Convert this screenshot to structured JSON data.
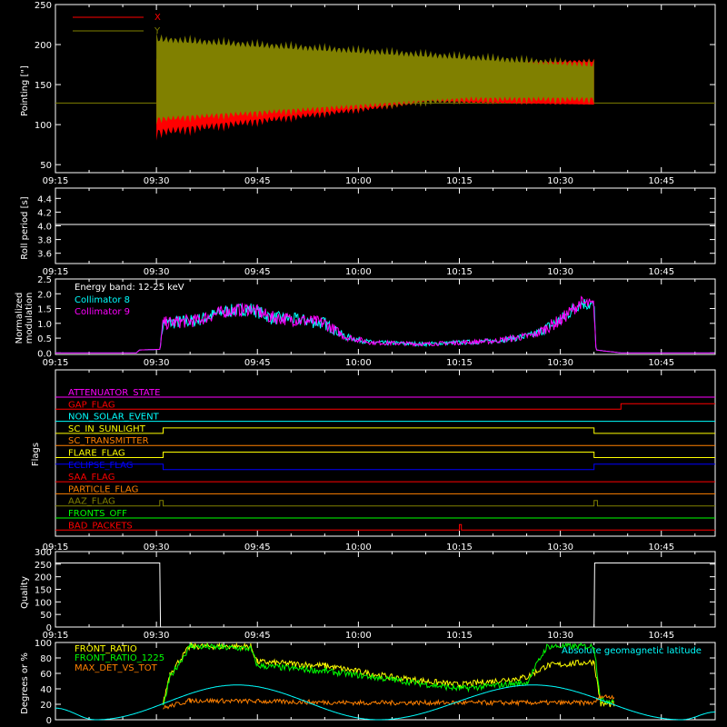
{
  "time_ticks": [
    "09:15",
    "09:30",
    "09:45",
    "10:00",
    "10:15",
    "10:30",
    "10:45"
  ],
  "chart_data": [
    {
      "type": "line",
      "id": "pointing",
      "ylabel": "Pointing [\"]",
      "ylim": [
        40,
        250
      ],
      "yticks": [
        50,
        100,
        150,
        200,
        250
      ],
      "xlim": [
        "09:15",
        "10:53"
      ],
      "legend": [
        {
          "name": "X",
          "color": "#ff0000"
        },
        {
          "name": "Y",
          "color": "#808000"
        }
      ],
      "reference_line": 127,
      "series": [
        {
          "name": "X",
          "color": "#ff0000",
          "start": "09:30",
          "end": "10:35",
          "upper": 183,
          "lower_start": 80,
          "lower_end": 125
        },
        {
          "name": "Y",
          "color": "#808000",
          "start": "09:30",
          "end": "10:35",
          "upper_peak": 215,
          "upper_end": 183,
          "lower_start": 100,
          "lower_end": 125
        }
      ]
    },
    {
      "type": "line",
      "id": "roll",
      "ylabel": "Roll period [s]",
      "ylim": [
        3.45,
        4.55
      ],
      "yticks": [
        3.6,
        3.8,
        4.0,
        4.2,
        4.4
      ],
      "value": 4.02
    },
    {
      "type": "line",
      "id": "modulation",
      "ylabel": [
        "Normalized",
        "modulation"
      ],
      "ylim": [
        -0.05,
        2.5
      ],
      "yticks": [
        0.0,
        0.5,
        1.0,
        1.5,
        2.0,
        2.5
      ],
      "annotation": "Energy band: 12-25 keV",
      "series": [
        {
          "name": "Collimator 8",
          "color": "#00ffff"
        },
        {
          "name": "Collimator 9",
          "color": "#ff00ff"
        }
      ],
      "profile": [
        [
          "09:15",
          0.0
        ],
        [
          "09:27",
          0.0
        ],
        [
          "09:27.5",
          0.1
        ],
        [
          "09:30.5",
          0.12
        ],
        [
          "09:31",
          1.0
        ],
        [
          "09:36",
          1.1
        ],
        [
          "09:40",
          1.4
        ],
        [
          "09:44",
          1.5
        ],
        [
          "09:47",
          1.2
        ],
        [
          "09:52",
          1.1
        ],
        [
          "09:55",
          1.0
        ],
        [
          "09:58",
          0.55
        ],
        [
          "10:02",
          0.35
        ],
        [
          "10:10",
          0.3
        ],
        [
          "10:15",
          0.35
        ],
        [
          "10:20",
          0.4
        ],
        [
          "10:26",
          0.6
        ],
        [
          "10:30",
          1.1
        ],
        [
          "10:33",
          1.7
        ],
        [
          "10:35",
          1.6
        ],
        [
          "10:35.3",
          0.1
        ],
        [
          "10:39",
          0.0
        ],
        [
          "10:53",
          0.0
        ]
      ]
    },
    {
      "type": "line",
      "id": "flags",
      "ylabel": "Flags",
      "flags": [
        {
          "name": "ATTENUATOR_STATE",
          "color": "#ff00ff",
          "steps": [
            [
              "09:15",
              0
            ],
            [
              "10:53",
              0
            ]
          ]
        },
        {
          "name": "GAP_FLAG",
          "color": "#ff0000",
          "steps": [
            [
              "09:15",
              0
            ],
            [
              "10:39",
              1
            ],
            [
              "10:53",
              1
            ]
          ]
        },
        {
          "name": "NON_SOLAR_EVENT",
          "color": "#00ffff",
          "steps": [
            [
              "09:15",
              0
            ],
            [
              "10:53",
              0
            ]
          ]
        },
        {
          "name": "SC_IN_SUNLIGHT",
          "color": "#ffff00",
          "steps": [
            [
              "09:15",
              0
            ],
            [
              "09:31",
              1
            ],
            [
              "10:35",
              0
            ],
            [
              "10:53",
              0
            ]
          ]
        },
        {
          "name": "SC_TRANSMITTER",
          "color": "#ff8000",
          "steps": [
            [
              "09:15",
              0
            ],
            [
              "10:53",
              0
            ]
          ]
        },
        {
          "name": "FLARE_FLAG",
          "color": "#ffff00",
          "steps": [
            [
              "09:15",
              0
            ],
            [
              "09:31",
              1
            ],
            [
              "10:35",
              0
            ],
            [
              "10:53",
              0
            ]
          ]
        },
        {
          "name": "ECLIPSE_FLAG",
          "color": "#0000ff",
          "steps": [
            [
              "09:15",
              1
            ],
            [
              "09:31",
              0
            ],
            [
              "10:35",
              1
            ],
            [
              "10:53",
              1
            ]
          ]
        },
        {
          "name": "SAA_FLAG",
          "color": "#ff0000",
          "steps": [
            [
              "09:15",
              0
            ],
            [
              "10:53",
              0
            ]
          ]
        },
        {
          "name": "PARTICLE_FLAG",
          "color": "#ff8000",
          "steps": [
            [
              "09:15",
              0
            ],
            [
              "10:53",
              0
            ]
          ]
        },
        {
          "name": "AAZ_FLAG",
          "color": "#808000",
          "steps": [
            [
              "09:15",
              0
            ],
            [
              "09:30.5",
              1
            ],
            [
              "09:31",
              0
            ],
            [
              "10:35",
              1
            ],
            [
              "10:35.5",
              0
            ],
            [
              "10:53",
              0
            ]
          ]
        },
        {
          "name": "FRONTS_OFF",
          "color": "#00ff00",
          "steps": [
            [
              "09:15",
              0
            ],
            [
              "10:53",
              0
            ]
          ]
        },
        {
          "name": "BAD_PACKETS",
          "color": "#ff0000",
          "steps": [
            [
              "09:15",
              0
            ],
            [
              "10:15",
              1
            ],
            [
              "10:15.3",
              0
            ],
            [
              "10:53",
              0
            ]
          ]
        }
      ]
    },
    {
      "type": "line",
      "id": "quality",
      "ylabel": "Quality",
      "ylim": [
        0,
        300
      ],
      "yticks": [
        0,
        50,
        100,
        150,
        200,
        250,
        300
      ],
      "steps": [
        [
          "09:15",
          255
        ],
        [
          "09:30.5",
          255
        ],
        [
          "09:30.6",
          0
        ],
        [
          "10:35",
          0
        ],
        [
          "10:35.1",
          255
        ],
        [
          "10:53",
          255
        ]
      ]
    },
    {
      "type": "line",
      "id": "ratios",
      "ylabel": "Degrees or %",
      "ylim": [
        0,
        100
      ],
      "yticks": [
        0,
        20,
        40,
        60,
        80,
        100
      ],
      "series": [
        {
          "name": "FRONT_RATIO",
          "color": "#ffff00",
          "points": [
            [
              "09:31",
              20
            ],
            [
              "09:32",
              60
            ],
            [
              "09:35",
              95
            ],
            [
              "09:44",
              95
            ],
            [
              "09:45",
              75
            ],
            [
              "09:55",
              70
            ],
            [
              "10:05",
              55
            ],
            [
              "10:15",
              45
            ],
            [
              "10:25",
              55
            ],
            [
              "10:28",
              70
            ],
            [
              "10:35",
              75
            ],
            [
              "10:36",
              20
            ],
            [
              "10:38",
              20
            ]
          ]
        },
        {
          "name": "FRONT_RATIO_1225",
          "color": "#00ff00",
          "points": [
            [
              "09:31",
              15
            ],
            [
              "09:32",
              55
            ],
            [
              "09:35",
              95
            ],
            [
              "09:44",
              92
            ],
            [
              "09:45",
              70
            ],
            [
              "09:55",
              63
            ],
            [
              "10:05",
              52
            ],
            [
              "10:15",
              40
            ],
            [
              "10:25",
              48
            ],
            [
              "10:28",
              95
            ],
            [
              "10:35",
              95
            ],
            [
              "10:36",
              25
            ],
            [
              "10:38",
              25
            ]
          ]
        },
        {
          "name": "MAX_DET_VS_TOT",
          "color": "#ff8000",
          "points": [
            [
              "09:31",
              15
            ],
            [
              "09:35",
              25
            ],
            [
              "10:00",
              22
            ],
            [
              "10:35",
              22
            ],
            [
              "10:36",
              30
            ],
            [
              "10:38",
              30
            ]
          ]
        },
        {
          "name": "Absolute geomagnetic latitude",
          "color": "#00ffff",
          "points": [
            [
              "09:15",
              15
            ],
            [
              "09:21",
              0
            ],
            [
              "09:42",
              45
            ],
            [
              "10:03",
              0
            ],
            [
              "10:26",
              45
            ],
            [
              "10:48",
              0
            ],
            [
              "10:53",
              10
            ]
          ]
        }
      ]
    }
  ]
}
